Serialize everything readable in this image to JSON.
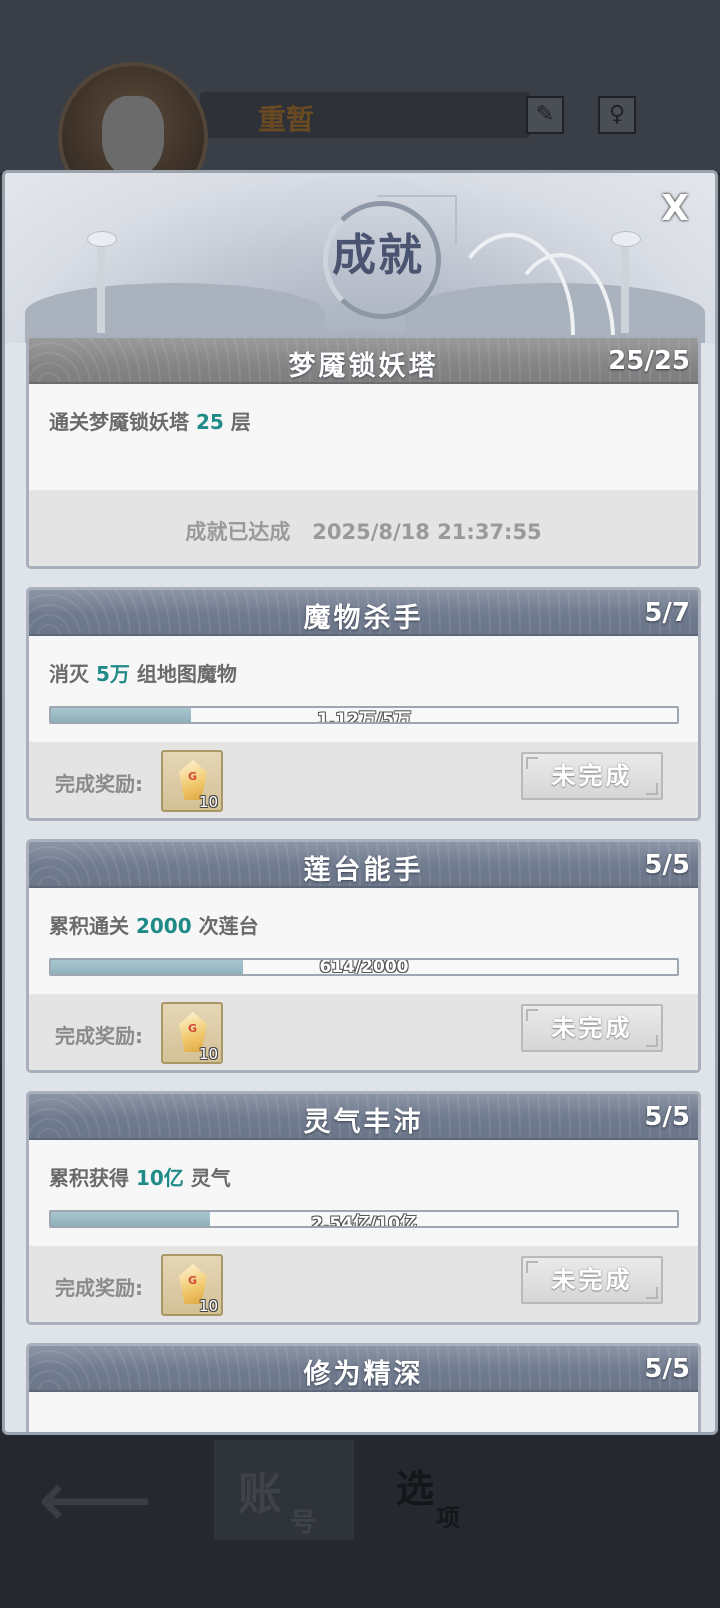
{
  "background": {
    "player_name": "重暂",
    "tabs": [
      {
        "big": "账",
        "small": "号"
      },
      {
        "big": "选",
        "small": "项"
      }
    ]
  },
  "modal": {
    "title": "成就",
    "close_label": "X"
  },
  "achievements": [
    {
      "title": "梦魇锁妖塔",
      "count": "25/25",
      "desc_prefix": "通关梦魇锁妖塔",
      "desc_value": "25",
      "desc_suffix": "层",
      "completed_text": "成就已达成   2025/8/18 21:37:55"
    },
    {
      "title": "魔物杀手",
      "count": "5/7",
      "desc_prefix": "消灭",
      "desc_value": "5万",
      "desc_suffix": "组地图魔物",
      "progress_text": "1.12万/5万",
      "progress": 0.224,
      "reward_label": "完成奖励:",
      "reward_qty": "10",
      "status": "未完成"
    },
    {
      "title": "莲台能手",
      "count": "5/5",
      "desc_prefix": "累积通关",
      "desc_value": "2000",
      "desc_suffix": "次莲台",
      "progress_text": "614/2000",
      "progress": 0.307,
      "reward_label": "完成奖励:",
      "reward_qty": "10",
      "status": "未完成"
    },
    {
      "title": "灵气丰沛",
      "count": "5/5",
      "desc_prefix": "累积获得",
      "desc_value": "10亿",
      "desc_suffix": "灵气",
      "progress_text": "2.54亿/10亿",
      "progress": 0.254,
      "reward_label": "完成奖励:",
      "reward_qty": "10",
      "status": "未完成"
    },
    {
      "title": "修为精深",
      "count": "5/5"
    }
  ],
  "colors": {
    "highlight": "#1f8a86",
    "header_blue": "#6f7a8e",
    "header_gray": "#858585",
    "progress_fill": "#8fb1bd"
  }
}
